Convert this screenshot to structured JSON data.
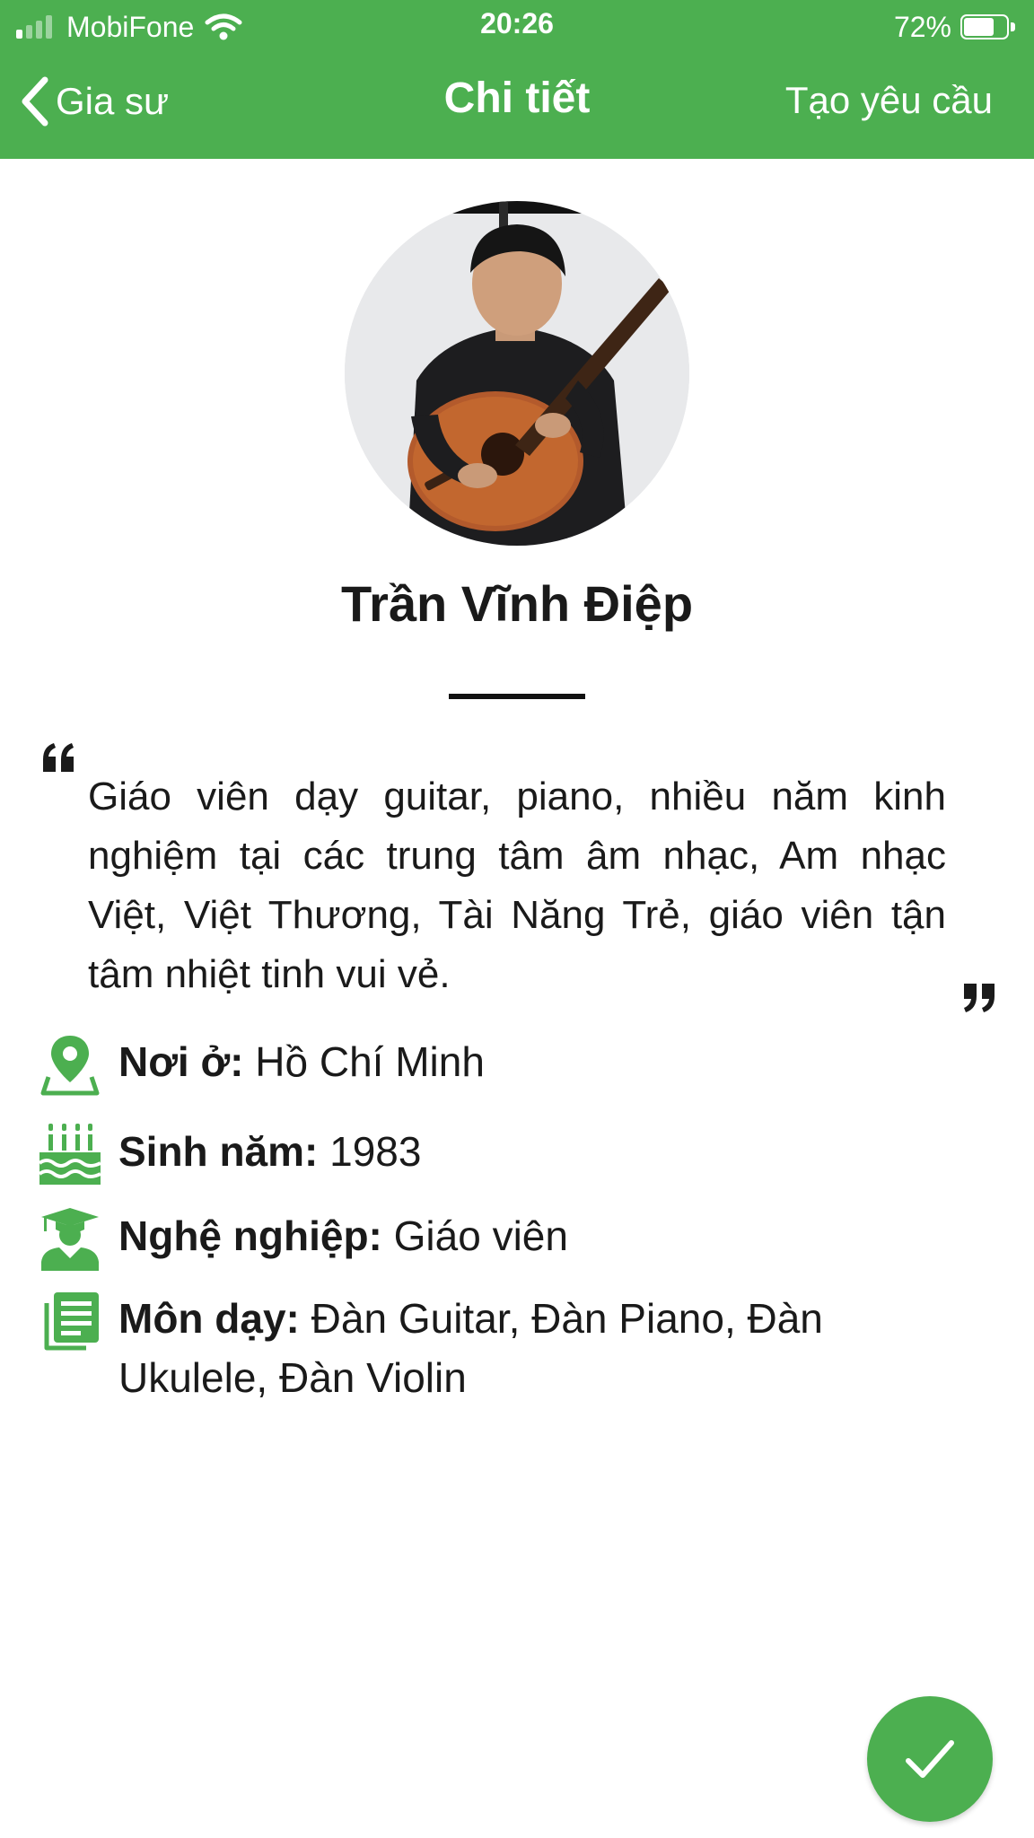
{
  "status_bar": {
    "carrier": "MobiFone",
    "time": "20:26",
    "battery_percent": "72%",
    "battery_level": 0.72,
    "signal_bars_filled": 1,
    "signal_bars_total": 4
  },
  "nav": {
    "back_label": "Gia sư",
    "title": "Chi tiết",
    "action_label": "Tạo yêu cầu"
  },
  "tutor": {
    "name": "Trần Vĩnh Điệp",
    "bio": "Giáo viên dạy guitar, piano, nhiều năm kinh nghiệm tại các trung tâm âm nhạc,  Am nhạc Việt, Việt Thương,  Tài Năng Trẻ, giáo viên tận tâm nhiệt tinh vui vẻ.",
    "details": {
      "location": {
        "label": "Nơi ở:",
        "value": "Hồ Chí Minh",
        "icon": "location-pin-icon"
      },
      "birth_year": {
        "label": "Sinh năm:",
        "value": "1983",
        "icon": "birthday-cake-icon"
      },
      "occupation": {
        "label": "Nghệ nghiệp:",
        "value": "Giáo viên",
        "icon": "graduate-icon"
      },
      "subjects": {
        "label": "Môn dạy:",
        "value": "Đàn Guitar, Đàn Piano, Đàn Ukulele, Đàn Violin",
        "icon": "notes-icon"
      }
    }
  },
  "colors": {
    "primary": "#4caf50",
    "header_text": "#ffffff",
    "body_text": "#1a1a1a"
  },
  "fab": {
    "icon": "checkmark-icon"
  }
}
